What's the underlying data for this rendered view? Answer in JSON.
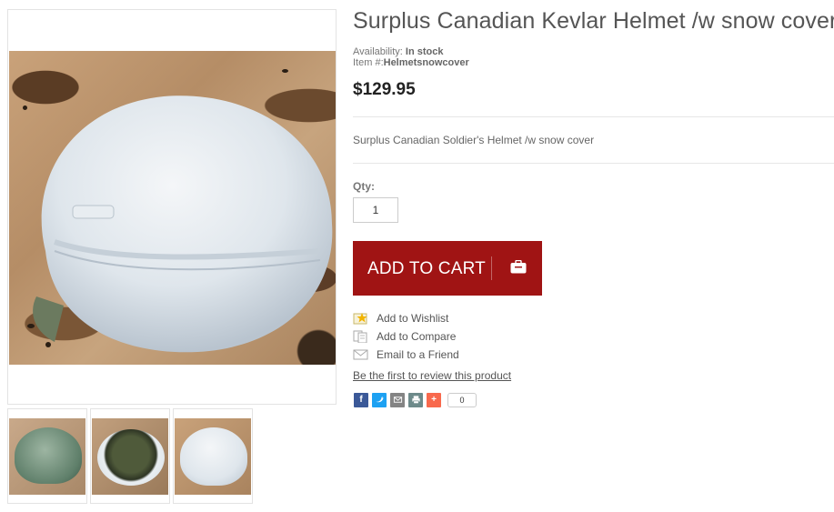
{
  "product": {
    "title": "Surplus Canadian Kevlar Helmet /w snow cover",
    "availability_label": "Availability: ",
    "availability_value": "In stock",
    "item_label": "Item #:",
    "item_value": "Helmetsnowcover",
    "price": "$129.95",
    "short_description": "Surplus Canadian Soldier's Helmet /w snow cover"
  },
  "purchase": {
    "qty_label": "Qty:",
    "qty_value": "1",
    "add_to_cart_label": "ADD TO CART",
    "cart_icon": "shopping-bag-icon"
  },
  "links": {
    "wishlist": "Add to Wishlist",
    "compare": "Add to Compare",
    "email": "Email to a Friend",
    "review": "Be the first to review this product"
  },
  "share": {
    "buttons": [
      "facebook-icon",
      "twitter-icon",
      "email-icon",
      "print-icon",
      "addthis-plus-icon"
    ],
    "count": "0"
  },
  "gallery": {
    "thumbnails": [
      "helmet-outer-shell-thumbnail",
      "helmet-interior-thumbnail",
      "helmet-snow-cover-thumbnail"
    ]
  },
  "colors": {
    "cart_button": "#a01414",
    "facebook": "#3b5998",
    "twitter": "#1da1f2",
    "email": "#848484",
    "print": "#6d8a8a",
    "plus": "#f8694d"
  }
}
